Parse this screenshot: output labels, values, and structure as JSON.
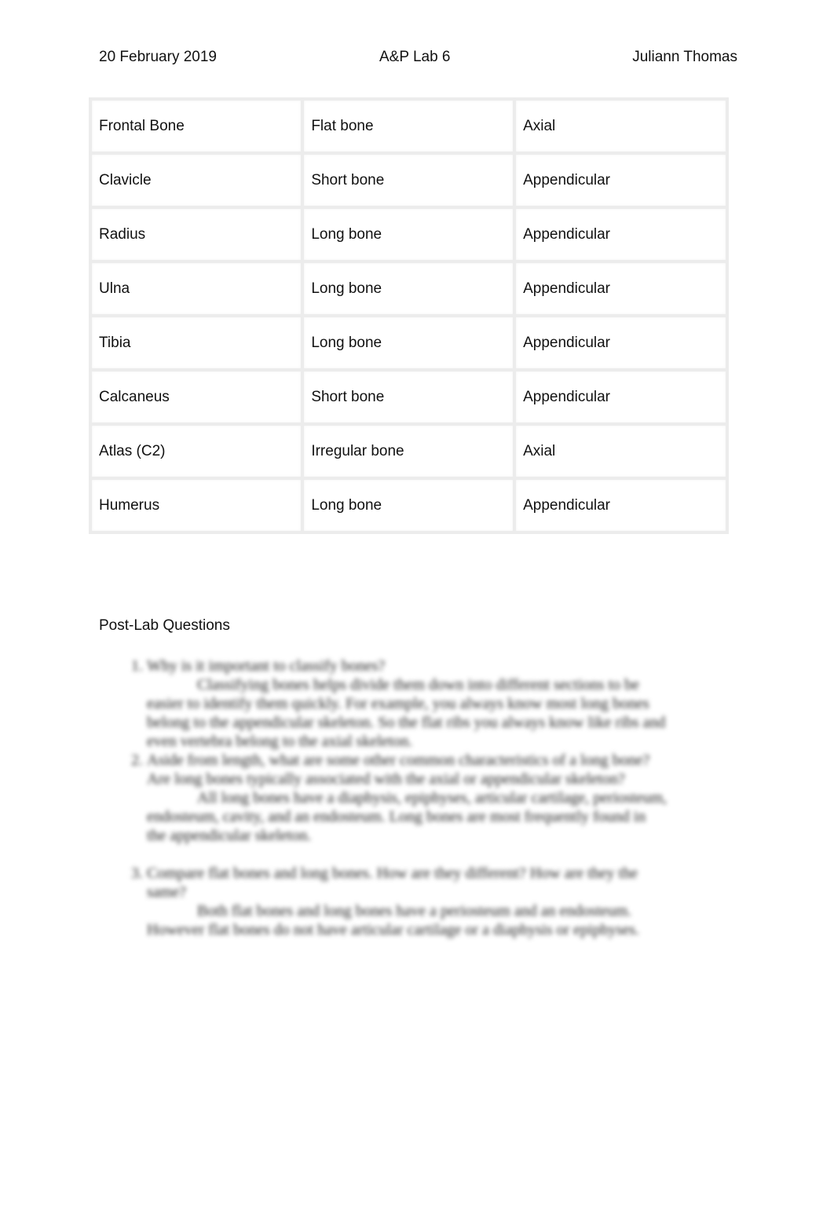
{
  "header": {
    "date": "20 February 2019",
    "title": "A&P Lab 6",
    "author": "Juliann Thomas"
  },
  "table": {
    "rows": [
      [
        "Frontal Bone",
        "Flat bone",
        "Axial"
      ],
      [
        "Clavicle",
        "Short bone",
        "Appendicular"
      ],
      [
        "Radius",
        "Long bone",
        "Appendicular"
      ],
      [
        "Ulna",
        "Long bone",
        "Appendicular"
      ],
      [
        "Tibia",
        "Long bone",
        "Appendicular"
      ],
      [
        "Calcaneus",
        "Short bone",
        "Appendicular"
      ],
      [
        "Atlas (C2)",
        "Irregular bone",
        "Axial"
      ],
      [
        "Humerus",
        "Long bone",
        "Appendicular"
      ]
    ]
  },
  "post_lab": {
    "heading": "Post-Lab Questions",
    "questions": [
      {
        "q": "Why is it important to classify bones?",
        "a": "Classifying bones helps divide them down into different sections to be easier to identify them quickly. For example, you always know most long bones belong to the appendicular skeleton. So the flat ribs you always know like ribs and even vertebra belong to the axial skeleton."
      },
      {
        "q": "Aside from length, what are some other common characteristics of a long bone? Are long bones typically associated with the axial or appendicular skeleton?",
        "a": "All long bones have a diaphysis, epiphyses, articular cartilage, periosteum, endosteum, cavity, and an endosteum. Long bones are most frequently found in the appendicular skeleton."
      },
      {
        "q": "Compare flat bones and long bones. How are they different? How are they the same?",
        "a": "Both flat bones and long bones have a periosteum and an endosteum. However flat bones do not have articular cartilage or a diaphysis or epiphyses."
      }
    ]
  }
}
